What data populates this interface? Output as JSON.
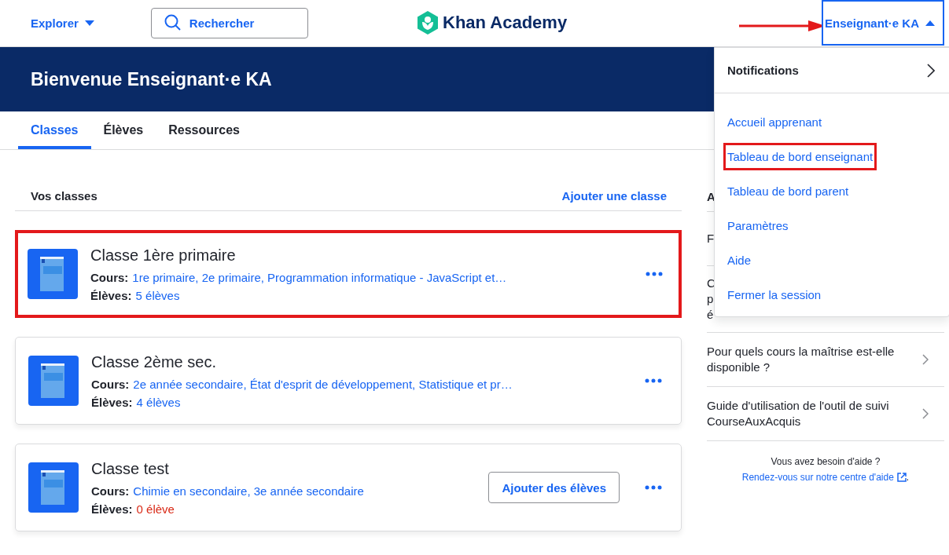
{
  "header": {
    "explore": "Explorer",
    "search_placeholder": "Rechercher",
    "logo": "Khan Academy",
    "user": {
      "label": "Enseignant·e KA",
      "expanded": true
    }
  },
  "banner": {
    "title": "Bienvenue Enseignant·e KA"
  },
  "tabs": [
    {
      "label": "Classes",
      "selected": true
    },
    {
      "label": "Élèves",
      "selected": false
    },
    {
      "label": "Ressources",
      "selected": false
    }
  ],
  "classes": {
    "heading": "Vos classes",
    "add_link": "Ajouter une classe",
    "items": [
      {
        "name": "Classe 1ère primaire",
        "courses_label": "Cours:",
        "courses": "1re primaire, 2e primaire, Programmation informatique - JavaScript et…",
        "students_label": "Élèves:",
        "students": "5 élèves",
        "empty": false,
        "highlighted": true
      },
      {
        "name": "Classe 2ème sec.",
        "courses_label": "Cours:",
        "courses": "2e année secondaire, État d'esprit de développement, Statistique et pr…",
        "students_label": "Élèves:",
        "students": "4 élèves",
        "empty": false,
        "highlighted": false
      },
      {
        "name": "Classe test",
        "courses_label": "Cours:",
        "courses": "Chimie en secondaire, 3e année secondaire",
        "students_label": "Élèves:",
        "students": "0 élève",
        "empty": true,
        "highlighted": false,
        "action": "Ajouter des élèves"
      }
    ]
  },
  "help_panel": {
    "heading": "A",
    "items": [
      {
        "lines": [
          "F"
        ],
        "chevron": false
      },
      {
        "lines": [
          "C",
          "p",
          "é"
        ],
        "chevron": false
      },
      {
        "lines": [
          "Pour quels cours la maîtrise est-elle",
          "disponible ?"
        ],
        "chevron": true
      },
      {
        "lines": [
          "Guide d'utilisation de l'outil de suivi",
          "CourseAuxAcquis"
        ],
        "chevron": true
      }
    ],
    "footer_text": "Vous avez besoin d'aide ?",
    "footer_link": "Rendez-vous sur notre centre d'aide",
    "footer_end": "."
  },
  "user_menu": {
    "notifications": "Notifications",
    "items": [
      {
        "label": "Accueil apprenant",
        "highlighted": false
      },
      {
        "label": "Tableau de bord enseignant",
        "highlighted": true
      },
      {
        "label": "Tableau de bord parent",
        "highlighted": false
      },
      {
        "label": "Paramètres",
        "highlighted": false
      },
      {
        "label": "Aide",
        "highlighted": false
      },
      {
        "label": "Fermer la session",
        "highlighted": false
      }
    ]
  }
}
